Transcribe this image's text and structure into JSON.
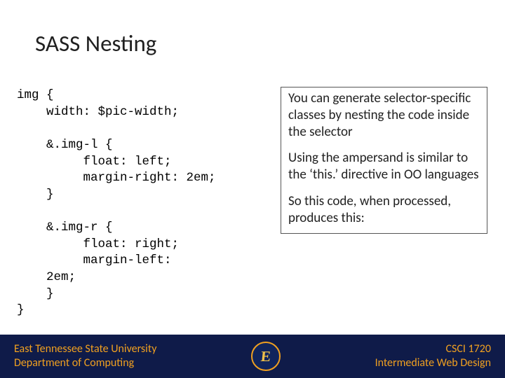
{
  "title": "SASS Nesting",
  "code": "img {\n    width: $pic-width;\n\n    &.img-l {\n         float: left;\n         margin-right: 2em;\n    }\n\n    &.img-r {\n         float: right;\n         margin-left:\n    2em;\n    }\n}",
  "explain": {
    "p1": "You can generate selector-specific classes by nesting the code inside the selector",
    "p2": "Using the ampersand is similar to the ‘this.’ directive in OO languages",
    "p3": "So this code, when processed, produces this:"
  },
  "footer": {
    "left_line1": "East Tennessee State University",
    "left_line2": "Department of Computing",
    "right_line1": "CSCI 1720",
    "right_line2": "Intermediate Web Design",
    "logo_letter": "E"
  }
}
